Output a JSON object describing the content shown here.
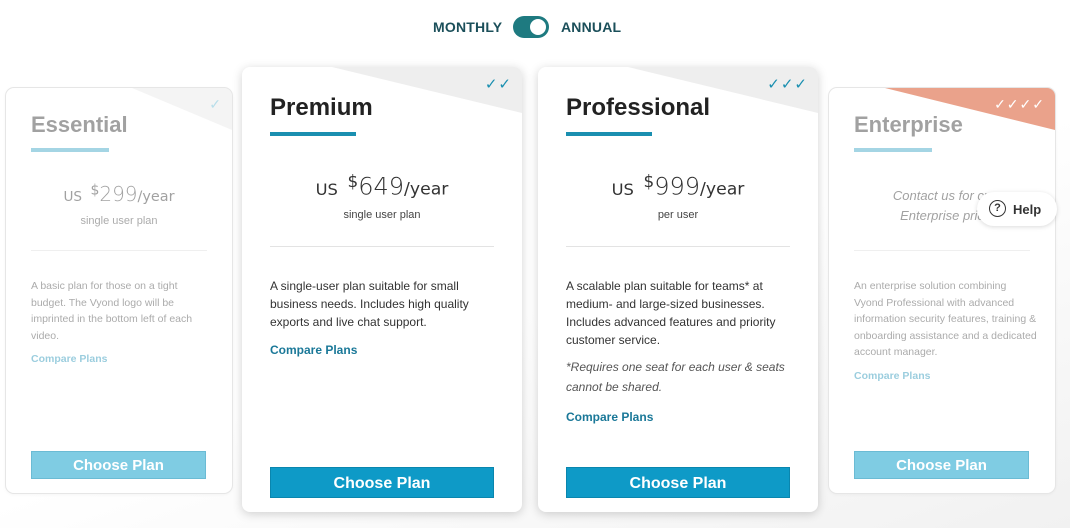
{
  "toggle": {
    "monthly": "MONTHLY",
    "annual": "ANNUAL",
    "state": "annual"
  },
  "colors": {
    "accent": "#0e9ac7",
    "toggle": "#1e7a80",
    "enterprise_corner": "#e8a58c"
  },
  "plans": [
    {
      "name": "Essential",
      "checks": "✓",
      "price": {
        "currency": "US",
        "symbol": "$",
        "amount": "299",
        "period": "/year"
      },
      "sub": "single user plan",
      "description": "A basic plan for those on a tight budget. The Vyond logo will be imprinted in the bottom left of each video.",
      "compare": "Compare Plans",
      "button": "Choose Plan"
    },
    {
      "name": "Premium",
      "checks": "✓✓",
      "price": {
        "currency": "US",
        "symbol": "$",
        "amount": "649",
        "period": "/year"
      },
      "sub": "single user plan",
      "description": "A single-user plan suitable for small business needs. Includes high quality exports and live chat support.",
      "compare": "Compare Plans",
      "button": "Choose Plan"
    },
    {
      "name": "Professional",
      "checks": "✓✓✓",
      "price": {
        "currency": "US",
        "symbol": "$",
        "amount": "999",
        "period": "/year"
      },
      "sub": "per user",
      "description": "A scalable plan suitable for teams* at medium- and large-sized businesses. Includes advanced features and priority customer service.",
      "note": "*Requires one seat for each user & seats cannot be shared.",
      "compare": "Compare Plans",
      "button": "Choose Plan"
    },
    {
      "name": "Enterprise",
      "checks": "✓✓✓✓",
      "contact_line1": "Contact us for cu",
      "contact_line2": "Enterprise pric",
      "description": "An enterprise solution combining Vyond Professional with advanced information security features, training & onboarding assistance and a dedicated account manager.",
      "compare": "Compare Plans",
      "button": "Choose Plan"
    }
  ],
  "help": {
    "label": "Help",
    "icon": "question-circle-icon"
  }
}
